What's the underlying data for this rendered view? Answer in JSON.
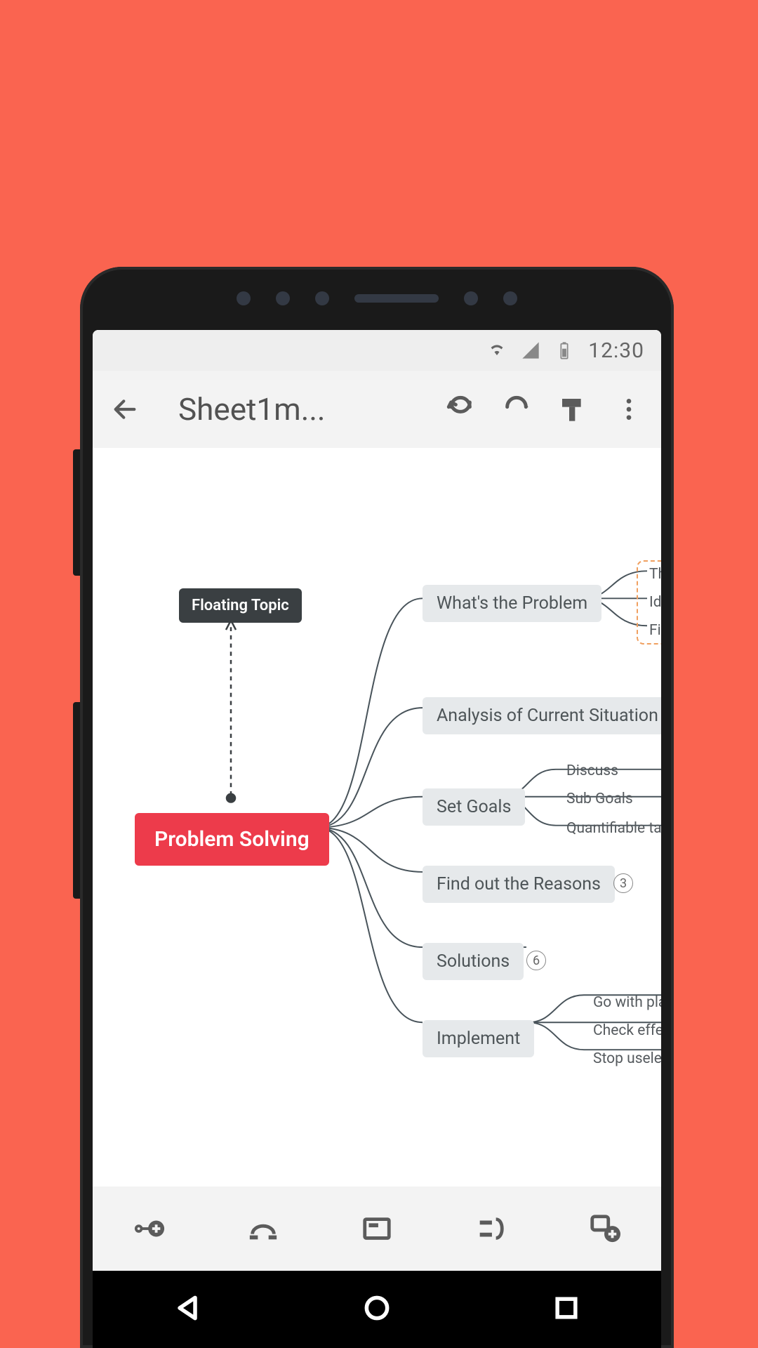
{
  "status": {
    "time": "12:30"
  },
  "appbar": {
    "title": "Sheet1m..."
  },
  "mindmap": {
    "root": "Problem Solving",
    "floating": "Floating Topic",
    "branches": {
      "b1": {
        "label": "What's the Problem",
        "subs": [
          "Th",
          "Ide",
          "Fin"
        ]
      },
      "b2": {
        "label": "Analysis of Current Situation"
      },
      "b3": {
        "label": "Set Goals",
        "subs": [
          "Discuss",
          "Sub Goals",
          "Quantifiable targe"
        ]
      },
      "b4": {
        "label": "Find out the Reasons",
        "count": "3"
      },
      "b5": {
        "label": "Solutions",
        "count": "6"
      },
      "b6": {
        "label": "Implement",
        "subs": [
          "Go with plans",
          "Check effect of",
          "Stop useless so"
        ]
      }
    }
  }
}
